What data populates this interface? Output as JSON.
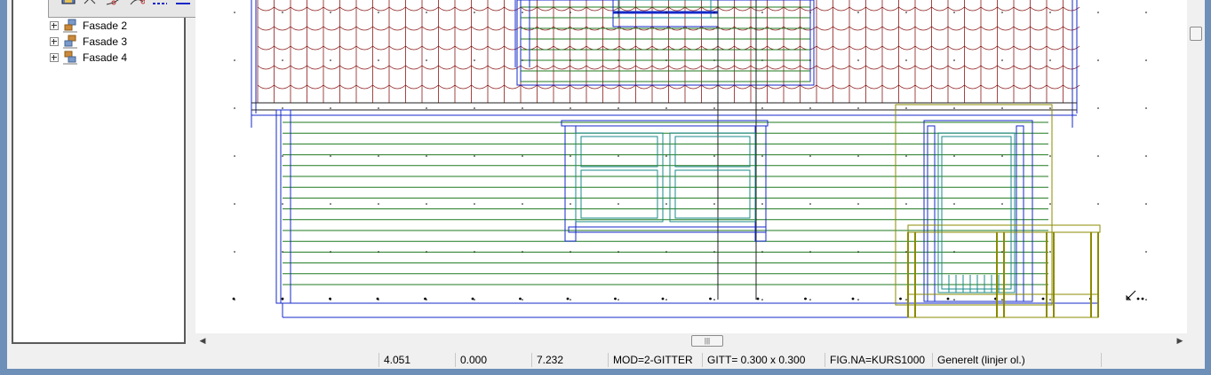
{
  "tree": {
    "items": [
      {
        "label": "Fasade 2"
      },
      {
        "label": "Fasade 3"
      },
      {
        "label": "Fasade 4"
      }
    ]
  },
  "toolbar": {
    "icons": [
      "layer-icon",
      "line-icon",
      "polyline-icon",
      "arc-icon",
      "dash-line-icon",
      "solid-line-icon",
      "image-icon",
      "zoom-icon"
    ]
  },
  "scrollbar": {
    "thumb_grip": "|||",
    "left_arrow": "◀",
    "right_arrow": "▶"
  },
  "status": {
    "x": "4.051",
    "y": "0.000",
    "z": "7.232",
    "mode": "MOD=2-GITTER",
    "grid": "GITT= 0.300 x 0.300",
    "figure": "FIG.NA=KURS1000",
    "layer": "Generelt (linjer ol.)"
  },
  "colors": {
    "roof": "#8b1a1a",
    "wall_lines": "#1f7a1f",
    "outline": "#1428c8",
    "window": "#1a8a8a",
    "railing": "#8b8b00"
  }
}
